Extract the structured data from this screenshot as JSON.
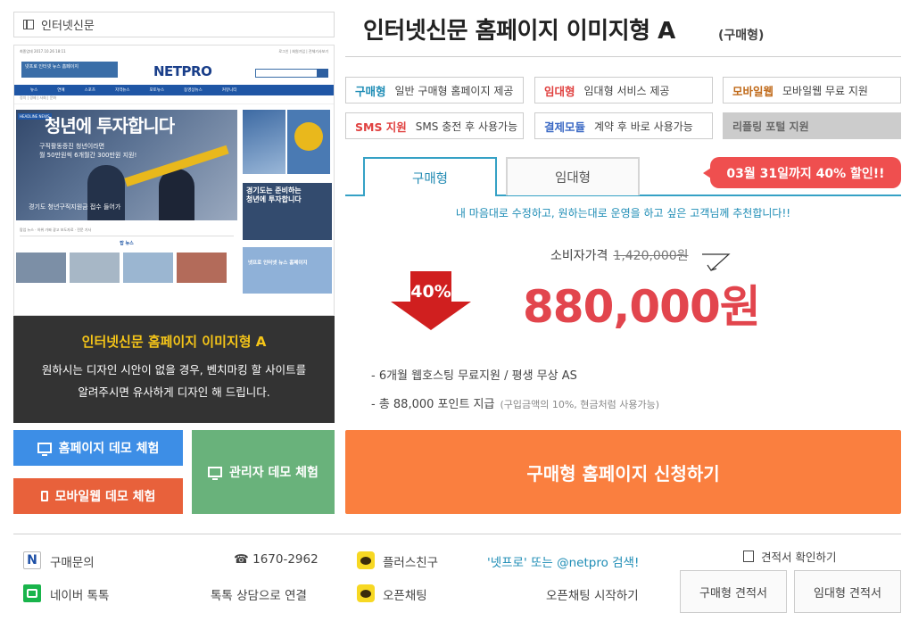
{
  "category": {
    "label": "인터넷신문"
  },
  "preview": {
    "top_left": "최종업데 2017.10.26 18:11",
    "top_right": "로그인 | 회원가입 | 전체기사보기",
    "banner": "넷프로 인터넷 뉴스 홈페이지",
    "logo": "NETPRO",
    "nav": [
      "뉴스",
      "연예",
      "스포츠",
      "지역뉴스",
      "포토뉴스",
      "동영상뉴스",
      "커뮤니티"
    ],
    "subnav": "정치 | 경제 | 사회 | 문화",
    "headline_tag": "HEADLINE NEWS",
    "headline": "청년에 투자합니다",
    "headline_sub": "구직활동증진 청년이라면\n월 50만원씩 6개월간 300만원 지원!",
    "headline_caption": "경기도 청년구직지원금 접수 들어가",
    "strip": "팝업 뉴스 · 하위 가짜 광고 보도자료 · 전문 기사",
    "hot": "탑 뉴스",
    "right_title": "경기도는 준비하는\n청년에 투자합니다",
    "right_ad": "넷프로 인터넷 뉴스 홈페이지"
  },
  "info_box": {
    "title": "인터넷신문 홈페이지 이미지형 A",
    "desc_line1": "원하시는 디자인 시안이 없을 경우, 벤치마킹 할 사이트를",
    "desc_line2": "알려주시면 유사하게 디자인 해 드립니다."
  },
  "buttons": {
    "home_demo": "홈페이지 데모 체험",
    "admin_demo": "관리자 데모 체험",
    "mobile_demo": "모바일웹 데모 체험",
    "apply": "구매형 홈페이지 신청하기"
  },
  "product": {
    "title": "인터넷신문 홈페이지 이미지형 A",
    "type": "(구매형)"
  },
  "features": [
    {
      "key": "구매형",
      "desc": "일반 구매형 홈페이지 제공"
    },
    {
      "key": "임대형",
      "desc": "임대형 서비스 제공"
    },
    {
      "key": "모바일웹",
      "desc": "모바일웹 무료 지원"
    },
    {
      "key": "SMS 지원",
      "desc": "SMS 충전 후 사용가능"
    },
    {
      "key": "결제모듈",
      "desc": "계약 후 바로 사용가능"
    },
    {
      "key": "리플링 포털 지원",
      "desc": ""
    }
  ],
  "tabs": [
    "구매형",
    "임대형"
  ],
  "sale_badge": "03월 31일까지 40% 할인!!",
  "tagline": "내 마음대로 수정하고, 원하는대로 운영을 하고 싶은 고객님께 추천합니다!!",
  "discount": "40%",
  "pricing": {
    "consumer_label": "소비자가격",
    "consumer_price": "1,420,000원",
    "price": "880,000원"
  },
  "bullets": {
    "b1": "- 6개월 웹호스팅 무료지원 / 평생 무상 AS",
    "b2": "- 총 88,000 포인트 지급",
    "b2_note": "(구입금액의 10%, 현금처럼 사용가능)"
  },
  "contact": {
    "inquiry_icon": "N",
    "inquiry_label": "구매문의",
    "phone": "☎ 1670-2962",
    "naver_label": "네이버 톡톡",
    "naver_action": "톡톡 상담으로 연결",
    "plus_label": "플러스친구",
    "plus_action": "'넷프로' 또는 @netpro 검색!",
    "open_label": "오픈채팅",
    "open_action": "오픈채팅 시작하기"
  },
  "estimate": {
    "check": "견적서 확인하기",
    "buy": "구매형 견적서",
    "rent": "임대형 견적서"
  },
  "colors": {
    "price_red": "#e2454d",
    "apply_orange": "#fa7f3f",
    "demo_blue": "#3d8ee6",
    "demo_green": "#69b27b",
    "demo_orange": "#e8613b",
    "tab_teal": "#35a1c5",
    "sale_red": "#ef4f4f"
  }
}
